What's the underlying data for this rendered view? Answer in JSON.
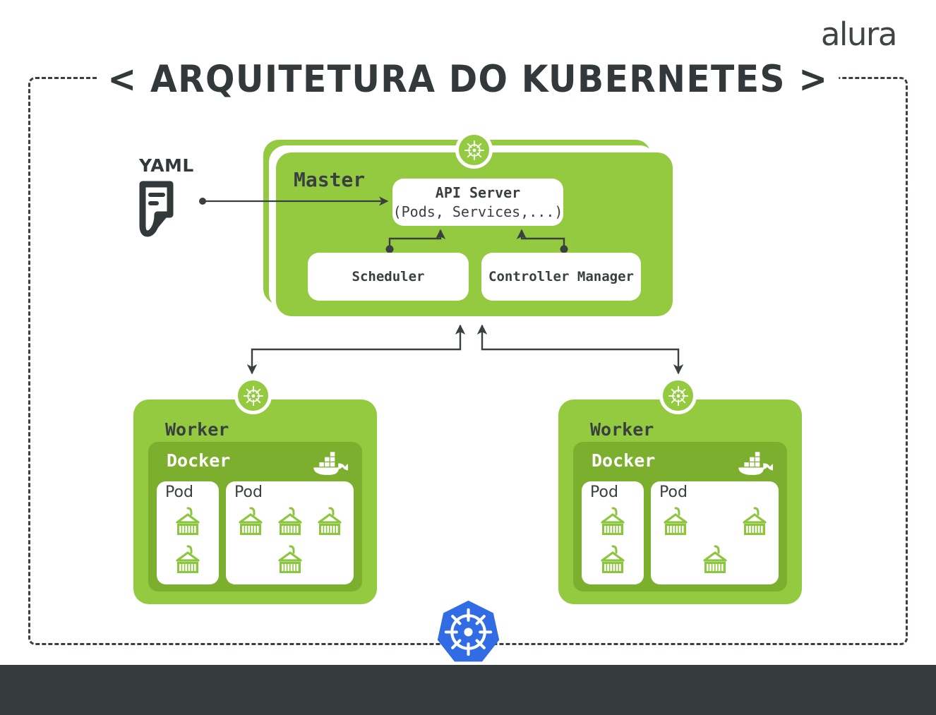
{
  "brand": {
    "logo_text": "alura"
  },
  "page": {
    "title": "< ARQUITETURA DO KUBERNETES >",
    "background_color": "#ffffff",
    "frame_style": "dashed",
    "frame_color": "#3a3f3f"
  },
  "colors": {
    "node_green": "#93ca3f",
    "docker_green": "#7caf2e",
    "text_dark": "#3a4040",
    "kubernetes_blue": "#326ce5",
    "footer_dark": "#353a3a",
    "connector": "#3a4040",
    "white": "#ffffff"
  },
  "yaml": {
    "label": "YAML",
    "icon": "yaml-file-icon"
  },
  "master": {
    "label": "Master",
    "badge_icon": "kubernetes-helm-icon",
    "components": [
      {
        "name": "api-server",
        "line1": "API Server",
        "line2": "(Pods, Services,...)"
      },
      {
        "name": "scheduler",
        "line1": "Scheduler"
      },
      {
        "name": "controller-manager",
        "line1": "Controller Manager"
      }
    ]
  },
  "workers": [
    {
      "id": "worker-left",
      "label": "Worker",
      "badge_icon": "kubernetes-helm-icon",
      "runtime": {
        "label": "Docker",
        "icon": "docker-whale-icon"
      },
      "pods": [
        {
          "label": "Pod",
          "size": "small",
          "containers": [
            1,
            1
          ]
        },
        {
          "label": "Pod",
          "size": "large",
          "containers": [
            1,
            1,
            1,
            1
          ]
        }
      ]
    },
    {
      "id": "worker-right",
      "label": "Worker",
      "badge_icon": "kubernetes-helm-icon",
      "runtime": {
        "label": "Docker",
        "icon": "docker-whale-icon"
      },
      "pods": [
        {
          "label": "Pod",
          "size": "small",
          "containers": [
            1,
            1
          ]
        },
        {
          "label": "Pod",
          "size": "large",
          "containers": [
            1,
            0,
            1,
            1
          ]
        }
      ]
    }
  ],
  "connections": [
    {
      "name": "yaml-to-api-server",
      "from": "yaml",
      "to": "api-server",
      "style": "line-with-dot-and-arrow"
    },
    {
      "name": "scheduler-to-api-server",
      "from": "scheduler",
      "to": "api-server",
      "style": "elbow-dot-to-arrow"
    },
    {
      "name": "controller-manager-to-api-server",
      "from": "controller-manager",
      "to": "api-server",
      "style": "elbow-dot-to-arrow"
    },
    {
      "name": "master-to-worker-left",
      "from": "master",
      "to": "worker-left",
      "style": "elbow-double-arrow"
    },
    {
      "name": "master-to-worker-right",
      "from": "master",
      "to": "worker-right",
      "style": "elbow-double-arrow"
    }
  ],
  "footer": {
    "logo_icon": "kubernetes-logo-icon"
  }
}
